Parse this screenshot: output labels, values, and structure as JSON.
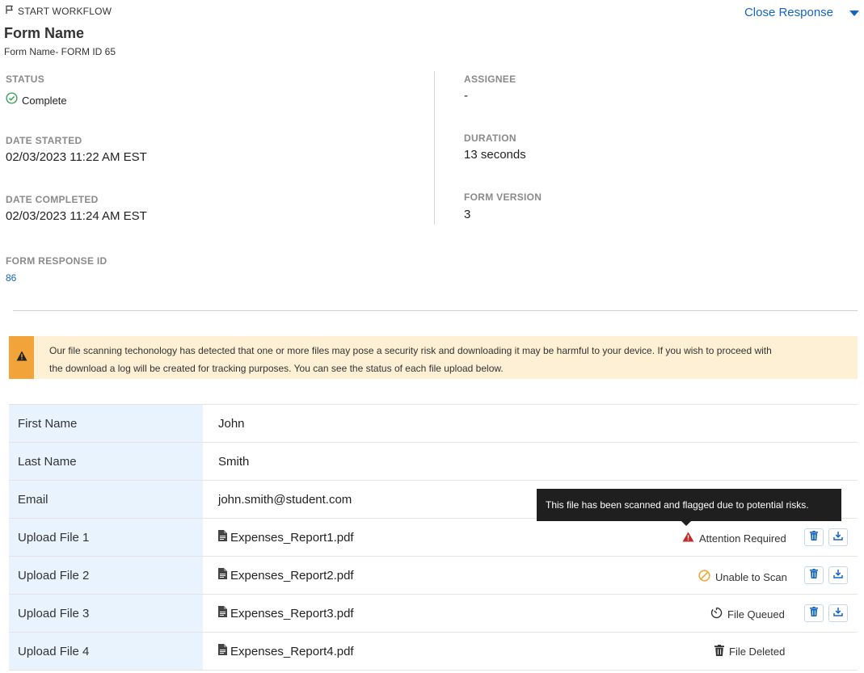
{
  "header": {
    "start_workflow": "START WORKFLOW",
    "title": "Form Name",
    "subtitle": "Form Name- FORM ID 65",
    "close_response": "Close Response"
  },
  "details": {
    "status_label": "STATUS",
    "status_value": "Complete",
    "date_started_label": "DATE STARTED",
    "date_started_value": "02/03/2023 11:22 AM EST",
    "date_completed_label": "DATE COMPLETED",
    "date_completed_value": "02/03/2023 11:24 AM EST",
    "form_response_id_label": "FORM RESPONSE ID",
    "form_response_id_value": "86",
    "assignee_label": "ASSIGNEE",
    "assignee_value": "-",
    "duration_label": "DURATION",
    "duration_value": "13 seconds",
    "form_version_label": "FORM VERSION",
    "form_version_value": "3"
  },
  "alert": {
    "line1": "Our file scanning techonology has detected that one or more files may pose a security risk and downloading it may be harmful to your device. If you wish to proceed with",
    "line2": "the download a log will be created for tracking purposes. You can see the status of each file upload below."
  },
  "fields": [
    {
      "label": "First Name",
      "value": "John"
    },
    {
      "label": "Last Name",
      "value": "Smith"
    },
    {
      "label": "Email",
      "value": "john.smith@student.com"
    },
    {
      "label": "Upload File 1",
      "value": "Expenses_Report1.pdf",
      "status": "Attention Required",
      "status_icon": "warning-icon"
    },
    {
      "label": "Upload File 2",
      "value": "Expenses_Report2.pdf",
      "status": "Unable to Scan",
      "status_icon": "blocked-icon"
    },
    {
      "label": "Upload File 3",
      "value": "Expenses_Report3.pdf",
      "status": "File Queued",
      "status_icon": "timer-icon"
    },
    {
      "label": "Upload File 4",
      "value": "Expenses_Report4.pdf",
      "status": "File Deleted",
      "status_icon": "trash-icon"
    }
  ],
  "tooltip": "This file has been scanned and flagged due to potential risks.",
  "colors": {
    "accent": "#1565c0",
    "success": "#2e9e4f",
    "danger": "#c62828",
    "warning": "#f2a43a",
    "label_bg": "#e8f3fd",
    "alert_bg": "#fdf0d5"
  }
}
